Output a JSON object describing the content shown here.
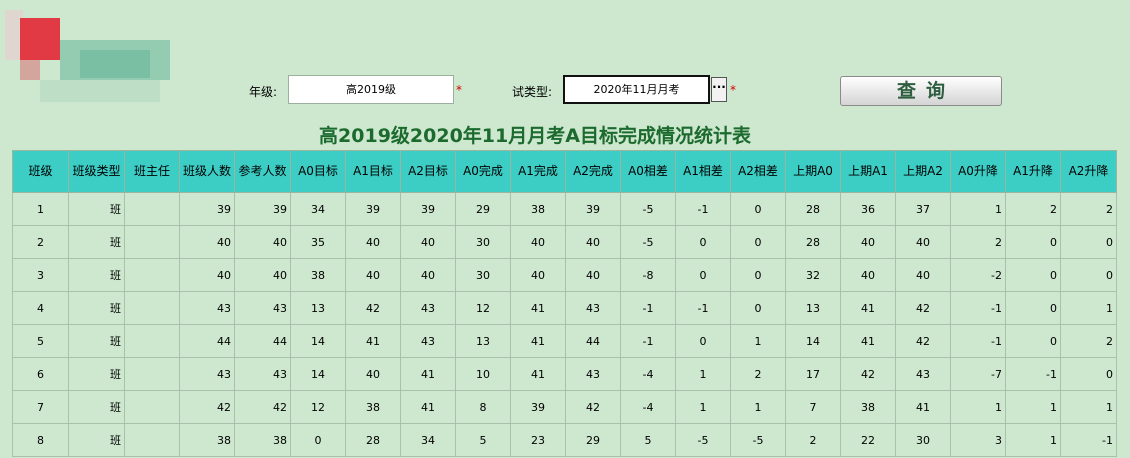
{
  "filters": {
    "grade_label": "年级:",
    "grade_value": "高2019级",
    "exam_label": "试类型:",
    "exam_value": "2020年11月月考",
    "ellipsis": "···",
    "required_mark": "*",
    "query_label": "查询"
  },
  "title": "高2019级2020年11月月考A目标完成情况统计表",
  "table": {
    "headers": [
      "班级",
      "班级类型",
      "班主任",
      "班级人数",
      "参考人数",
      "A0目标",
      "A1目标",
      "A2目标",
      "A0完成",
      "A1完成",
      "A2完成",
      "A0相差",
      "A1相差",
      "A2相差",
      "上期A0",
      "上期A1",
      "上期A2",
      "A0升降",
      "A1升降",
      "A2升降"
    ],
    "rows": [
      {
        "c": [
          "1",
          "班",
          "",
          "39",
          "39",
          "34",
          "39",
          "39",
          "29",
          "38",
          "39",
          "-5",
          "-1",
          "0",
          "28",
          "36",
          "37",
          "1",
          "2",
          "2"
        ]
      },
      {
        "c": [
          "2",
          "班",
          "",
          "40",
          "40",
          "35",
          "40",
          "40",
          "30",
          "40",
          "40",
          "-5",
          "0",
          "0",
          "28",
          "40",
          "40",
          "2",
          "0",
          "0"
        ]
      },
      {
        "c": [
          "3",
          "班",
          "",
          "40",
          "40",
          "38",
          "40",
          "40",
          "30",
          "40",
          "40",
          "-8",
          "0",
          "0",
          "32",
          "40",
          "40",
          "-2",
          "0",
          "0"
        ]
      },
      {
        "c": [
          "4",
          "班",
          "",
          "43",
          "43",
          "13",
          "42",
          "43",
          "12",
          "41",
          "43",
          "-1",
          "-1",
          "0",
          "13",
          "41",
          "42",
          "-1",
          "0",
          "1"
        ]
      },
      {
        "c": [
          "5",
          "班",
          "",
          "44",
          "44",
          "14",
          "41",
          "43",
          "13",
          "41",
          "44",
          "-1",
          "0",
          "1",
          "14",
          "41",
          "42",
          "-1",
          "0",
          "2"
        ]
      },
      {
        "c": [
          "6",
          "班",
          "",
          "43",
          "43",
          "14",
          "40",
          "41",
          "10",
          "41",
          "43",
          "-4",
          "1",
          "2",
          "17",
          "42",
          "43",
          "-7",
          "-1",
          "0"
        ]
      },
      {
        "c": [
          "7",
          "班",
          "",
          "42",
          "42",
          "12",
          "38",
          "41",
          "8",
          "39",
          "42",
          "-4",
          "1",
          "1",
          "7",
          "38",
          "41",
          "1",
          "1",
          "1"
        ]
      },
      {
        "c": [
          "8",
          "班",
          "",
          "38",
          "38",
          "0",
          "28",
          "34",
          "5",
          "23",
          "29",
          "5",
          "-5",
          "-5",
          "2",
          "22",
          "30",
          "3",
          "1",
          "-1"
        ]
      }
    ]
  },
  "colors": {
    "background": "#cde8cf",
    "header": "#3ccdc5",
    "title": "#1c6a2e",
    "required": "#d40000"
  }
}
